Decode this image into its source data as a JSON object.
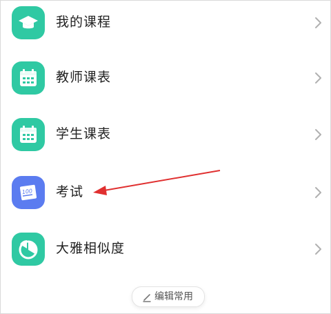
{
  "colors": {
    "teal_icon": "#2fc9a3",
    "blue_icon": "#5b7cf0",
    "label_text": "#222222",
    "chevron": "#b0b0b0",
    "annotation_arrow": "#e03030"
  },
  "menu": {
    "items": [
      {
        "label": "我的课程",
        "icon": "graduation-cap-icon"
      },
      {
        "label": "教师课表",
        "icon": "calendar-icon"
      },
      {
        "label": "学生课表",
        "icon": "calendar-icon"
      },
      {
        "label": "考试",
        "icon": "exam-score-icon"
      },
      {
        "label": "大雅相似度",
        "icon": "pie-chart-icon"
      }
    ]
  },
  "footer": {
    "edit_label": "编辑常用"
  }
}
